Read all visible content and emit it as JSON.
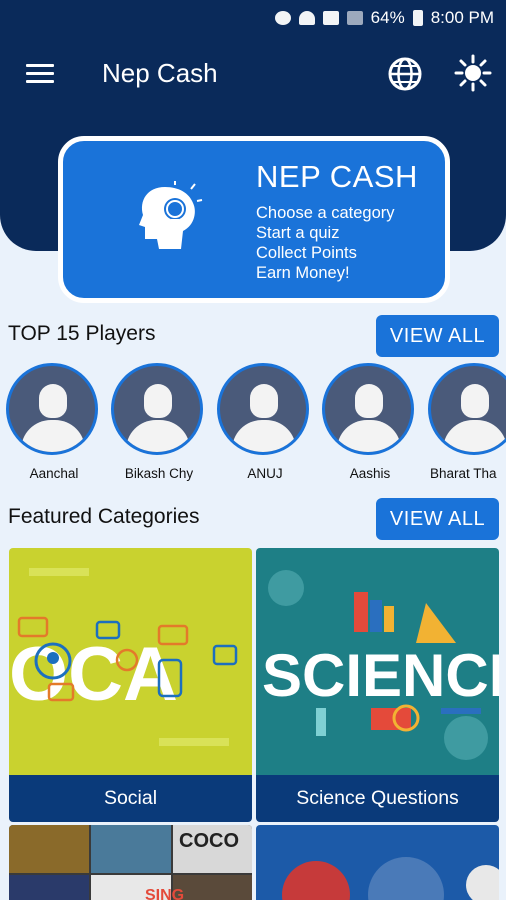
{
  "status_bar": {
    "battery": "64%",
    "time": "8:00 PM"
  },
  "app_bar": {
    "title": "Nep Cash",
    "menu_icon": "hamburger-icon",
    "language_icon": "globe-icon",
    "theme_icon": "sun-icon"
  },
  "hero": {
    "heading": "NEP CASH",
    "lines": [
      "Choose a category",
      "Start a quiz",
      "Collect Points",
      "Earn Money!"
    ]
  },
  "players_section": {
    "title": "TOP 15 Players",
    "view_all": "VIEW ALL",
    "players": [
      "Aanchal",
      "Bikash Chy",
      "ANUJ",
      "Aashis",
      "Bharat Tha"
    ]
  },
  "categories_section": {
    "title": "Featured Categories",
    "view_all": "VIEW ALL",
    "categories": [
      {
        "name": "Social",
        "art_text": "OCA"
      },
      {
        "name": "Science Questions",
        "art_text": "SCIENCE"
      }
    ],
    "more_art_text": [
      "COCO",
      "SING"
    ]
  },
  "colors": {
    "primary_dark": "#0a2a5a",
    "primary": "#1a73d9",
    "background": "#eaf2fb",
    "social_bg": "#c9d22f",
    "science_bg": "#1e7f86"
  }
}
